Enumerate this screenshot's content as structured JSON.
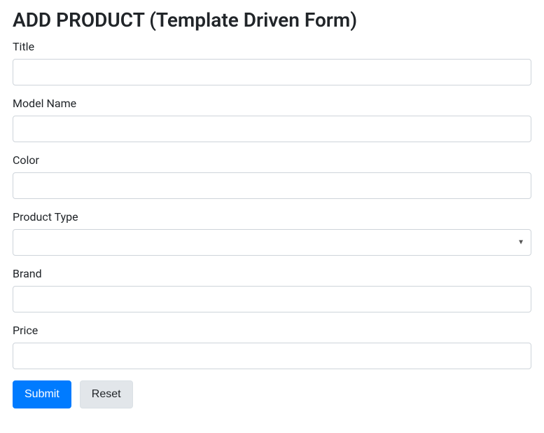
{
  "page": {
    "title": "ADD PRODUCT (Template Driven Form)"
  },
  "form": {
    "fields": {
      "title": {
        "label": "Title",
        "value": ""
      },
      "model_name": {
        "label": "Model Name",
        "value": ""
      },
      "color": {
        "label": "Color",
        "value": ""
      },
      "product_type": {
        "label": "Product Type",
        "selected": ""
      },
      "brand": {
        "label": "Brand",
        "value": ""
      },
      "price": {
        "label": "Price",
        "value": ""
      }
    },
    "buttons": {
      "submit": "Submit",
      "reset": "Reset"
    }
  }
}
